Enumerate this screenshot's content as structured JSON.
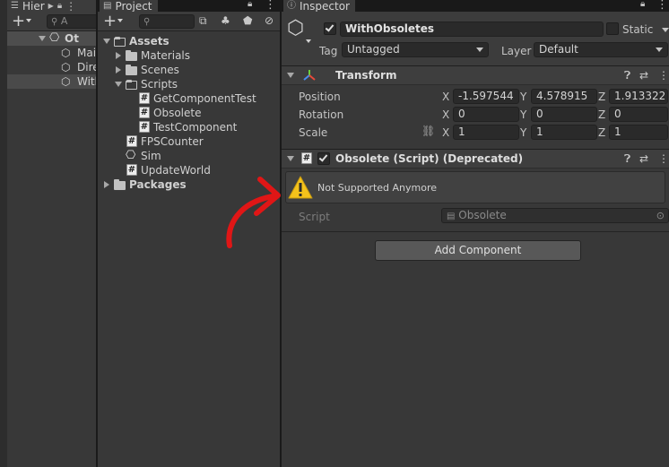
{
  "hierarchy": {
    "tab_label": "Hier",
    "search_placeholder": "A",
    "root_label": "Ot",
    "items": [
      {
        "label": "Mai"
      },
      {
        "label": "Dire"
      },
      {
        "label": "With"
      }
    ]
  },
  "project": {
    "tab_label": "Project",
    "tree": {
      "assets": "Assets",
      "materials": "Materials",
      "scenes": "Scenes",
      "scripts": "Scripts",
      "get_component_test": "GetComponentTest",
      "obsolete": "Obsolete",
      "test_component": "TestComponent",
      "fps_counter": "FPSCounter",
      "sim": "Sim",
      "update_world": "UpdateWorld",
      "packages": "Packages"
    }
  },
  "inspector": {
    "tab_label": "Inspector",
    "object_name": "WithObsoletes",
    "static_label": "Static",
    "tag_label": "Tag",
    "tag_value": "Untagged",
    "layer_label": "Layer",
    "layer_value": "Default",
    "transform": {
      "title": "Transform",
      "position_label": "Position",
      "rotation_label": "Rotation",
      "scale_label": "Scale",
      "axis_x": "X",
      "axis_y": "Y",
      "axis_z": "Z",
      "position": {
        "x": "-1.597544",
        "y": "4.578915",
        "z": "1.913322"
      },
      "rotation": {
        "x": "0",
        "y": "0",
        "z": "0"
      },
      "scale": {
        "x": "1",
        "y": "1",
        "z": "1"
      }
    },
    "obsolete_component": {
      "title": "Obsolete (Script) (Deprecated)",
      "warning_text": "Not Supported Anymore",
      "script_label": "Script",
      "script_value": "Obsolete"
    },
    "add_component_label": "Add Component"
  },
  "colors": {
    "panel_bg": "#383838",
    "field_bg": "#2a2a2a",
    "warning_yellow": "#f4c21b",
    "annotation_red": "#e01616"
  }
}
